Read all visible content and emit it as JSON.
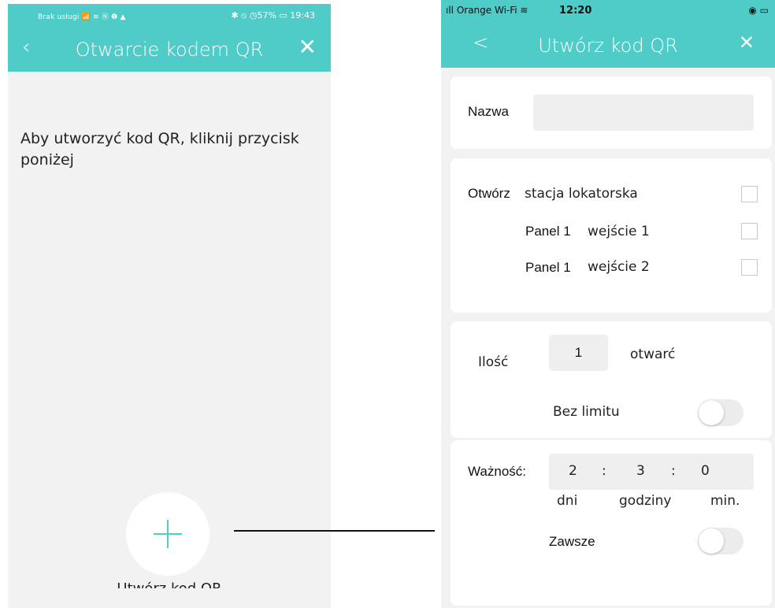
{
  "left": {
    "status_left": "Brak usługi 📶 ≋ Ⓝ ❶ ▲",
    "status_right": "✱ ⦸ ◷57% ▭ 19:43",
    "back_icon": "‹",
    "title": "Otwarcie kodem QR",
    "close_icon": "✕",
    "instruction": "Aby utworzyć kod QR, kliknij przycisk poniżej",
    "create_label": "Utwórz kod QR"
  },
  "right": {
    "carrier": "ıll Orange Wi-Fi ≋",
    "time": "12:20",
    "battery": "◉ ▭",
    "back_icon": "<",
    "title": "Utwórz kod QR",
    "close_icon": "✕",
    "name_label": "Nazwa",
    "name_value": "",
    "open_label": "Otwórz",
    "open_items": [
      {
        "panel": "",
        "label": "stacja lokatorska",
        "checked": false
      },
      {
        "panel": "Panel 1",
        "label": "wejście 1",
        "checked": false
      },
      {
        "panel": "Panel 1",
        "label": "wejście 2",
        "checked": false
      }
    ],
    "qty_label": "Ilość",
    "qty_value": "1",
    "qty_unit": "otwarć",
    "no_limit_label": "Bez limitu",
    "no_limit_on": false,
    "validity_label": "Ważność:",
    "days": "2",
    "hours": "3",
    "minutes": "0",
    "sep": ":",
    "days_label": "dni",
    "hours_label": "godziny",
    "minutes_label": "min.",
    "always_label": "Zawsze",
    "always_on": false
  },
  "colors": {
    "accent": "#4fcbc8",
    "background": "#f2f2f2",
    "card": "#ffffff"
  }
}
